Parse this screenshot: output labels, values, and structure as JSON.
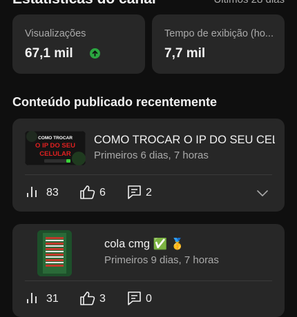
{
  "header": {
    "title": "Estatísticas do canal",
    "range": "Últimos 28 dias"
  },
  "stats": [
    {
      "label": "Visualizações",
      "value": "67,1 mil",
      "trend": "up",
      "trend_color": "#2ba640"
    },
    {
      "label": "Tempo de exibição (ho...",
      "value": "7,7 mil"
    }
  ],
  "section": {
    "title": "Conteúdo publicado recentemente"
  },
  "videos": [
    {
      "title": "COMO TROCAR O IP DO SEU CEL...",
      "subtitle": "Primeiros 6 dias, 7 horas",
      "thumb_text": [
        "COMO TROCAR",
        "O IP DO SEU",
        "CELULAR"
      ],
      "views": "83",
      "likes": "6",
      "comments": "2"
    },
    {
      "title": "cola cmg ✅ 🥇",
      "subtitle": "Primeiros 9 dias, 7 horas",
      "views": "31",
      "likes": "3",
      "comments": "0"
    }
  ],
  "icons": {
    "views": "bar-chart-icon",
    "likes": "thumbs-up-icon",
    "comments": "comment-icon",
    "expand": "chevron-down-icon"
  }
}
